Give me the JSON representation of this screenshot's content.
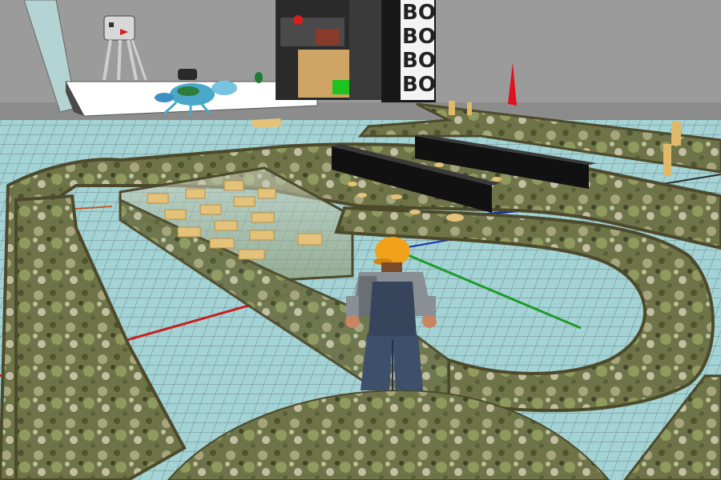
{
  "scene": {
    "type": "virtual-world-3d-view",
    "colors": {
      "sky": "#9b9b9b",
      "floor_tile": "#9fd2d4",
      "grid_line": "#5a6e74",
      "axis_red": "#c81e1e",
      "axis_blue": "#1a2fa8",
      "axis_green": "#1f9a2a",
      "track_edge": "#4d4a2c",
      "track_moss_dark": "#5b6436",
      "track_moss_light": "#a8aa7e",
      "barrier_black": "#111111",
      "plank": "#e4c27a",
      "avatar_hat": "#f1a21b",
      "avatar_overalls": "#36445c",
      "avatar_shirt": "#8a8f96",
      "avatar_skin": "#c98460",
      "marker_cone": "#e0121e",
      "display_panel": "#ffffff",
      "crab": "#4aa8c8"
    },
    "objects": {
      "avatar": "farmer-avatar-with-hard-hat",
      "track": "mossy-marble-run-track",
      "barriers": "black-barrier-beams",
      "planks": "wooden-plank-pieces",
      "robot": "walker-robot-model",
      "crab": "blue-crab-sculpture",
      "cone": "red-marker-cone",
      "shelf": "dark-shelf-unit"
    },
    "sign_poster": {
      "rows": [
        "BO",
        "BO",
        "BO",
        "BO"
      ]
    }
  }
}
